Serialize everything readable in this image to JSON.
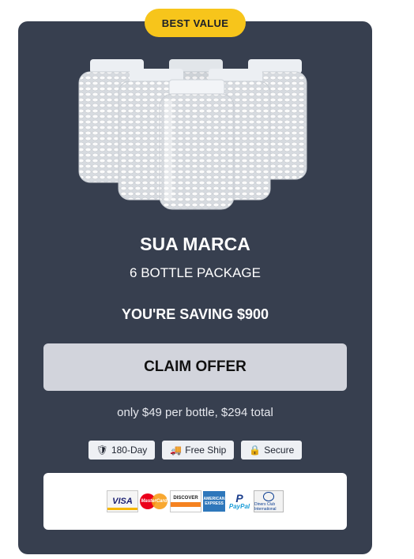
{
  "badge": "BEST VALUE",
  "product": {
    "brand": "SUA MARCA",
    "package": "6 BOTTLE PACKAGE",
    "saving": "YOU'RE SAVING $900",
    "cta": "CLAIM OFFER",
    "price_note": "only $49 per bottle, $294 total"
  },
  "trust": [
    {
      "icon": "shield-icon",
      "glyph": "🛡",
      "label": "180-Day"
    },
    {
      "icon": "truck-icon",
      "glyph": "🚚",
      "label": "Free Ship"
    },
    {
      "icon": "lock-icon",
      "glyph": "🔒",
      "label": "Secure"
    }
  ],
  "payments": {
    "visa": "VISA",
    "mastercard": "MasterCard",
    "discover": "DISCOVER",
    "amex": "AMERICAN EXPRESS",
    "paypal_p": "P",
    "paypal": "PayPal",
    "diners": "Diners Club International"
  },
  "colors": {
    "card": "#373f4f",
    "badge": "#f7c51b",
    "cta": "#d2d4dc"
  }
}
